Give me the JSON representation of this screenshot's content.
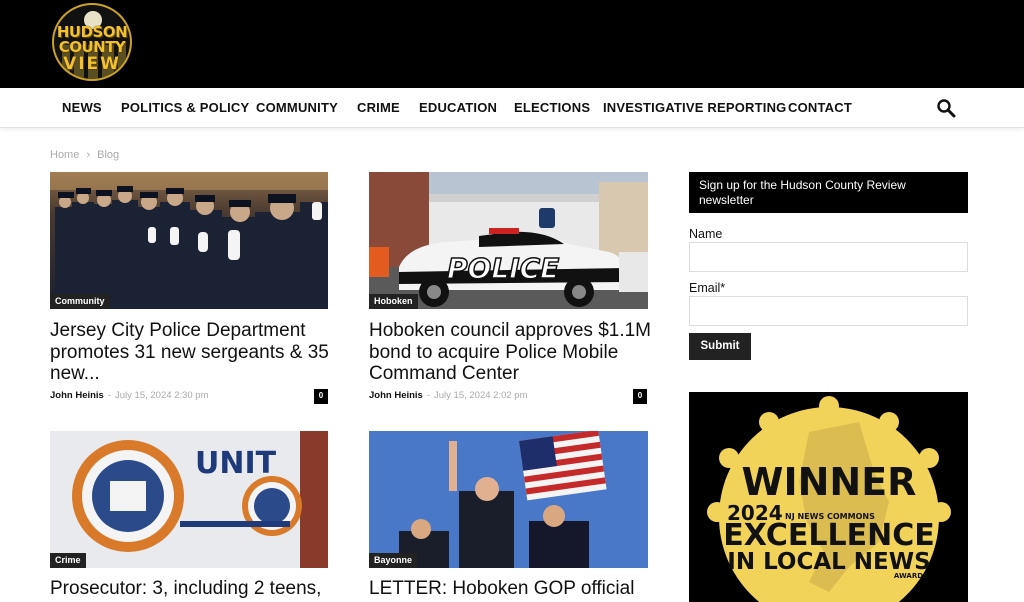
{
  "site": {
    "logo_lines": [
      "HUDSON",
      "COUNTY",
      "VIEW"
    ]
  },
  "nav": {
    "items": [
      "NEWS",
      "POLITICS & POLICY",
      "COMMUNITY",
      "CRIME",
      "EDUCATION",
      "ELECTIONS",
      "INVESTIGATIVE REPORTING",
      "CONTACT"
    ],
    "search_icon": "search-icon"
  },
  "breadcrumb": {
    "home": "Home",
    "separator": "›",
    "current": "Blog"
  },
  "posts": [
    {
      "category": "Community",
      "title": "Jersey City Police Department promotes 31 new sergeants & 35 new...",
      "author": "John Heinis",
      "date": "July 15, 2024 2:30 pm",
      "comments": "0"
    },
    {
      "category": "Hoboken",
      "title": "Hoboken council approves $1.1M bond to acquire Police Mobile Command Center",
      "author": "John Heinis",
      "date": "July 15, 2024 2:02 pm",
      "comments": "0"
    },
    {
      "category": "Crime",
      "title": "Prosecutor: 3, including 2 teens,"
    },
    {
      "category": "Bayonne",
      "title": "LETTER: Hoboken GOP official"
    }
  ],
  "sidebar": {
    "newsletter_title": "Sign up for the Hudson County Review newsletter",
    "name_label": "Name",
    "email_label": "Email*",
    "submit_label": "Submit",
    "ad": {
      "line1": "WINNER",
      "line2": "2024",
      "line2_small": "NJ NEWS COMMONS",
      "line3": "EXCELLENCE",
      "line4": "IN LOCAL NEWS",
      "line5": "AWARDS"
    }
  },
  "colors": {
    "accent": "#000000",
    "badge_gold": "#f2d35a"
  }
}
